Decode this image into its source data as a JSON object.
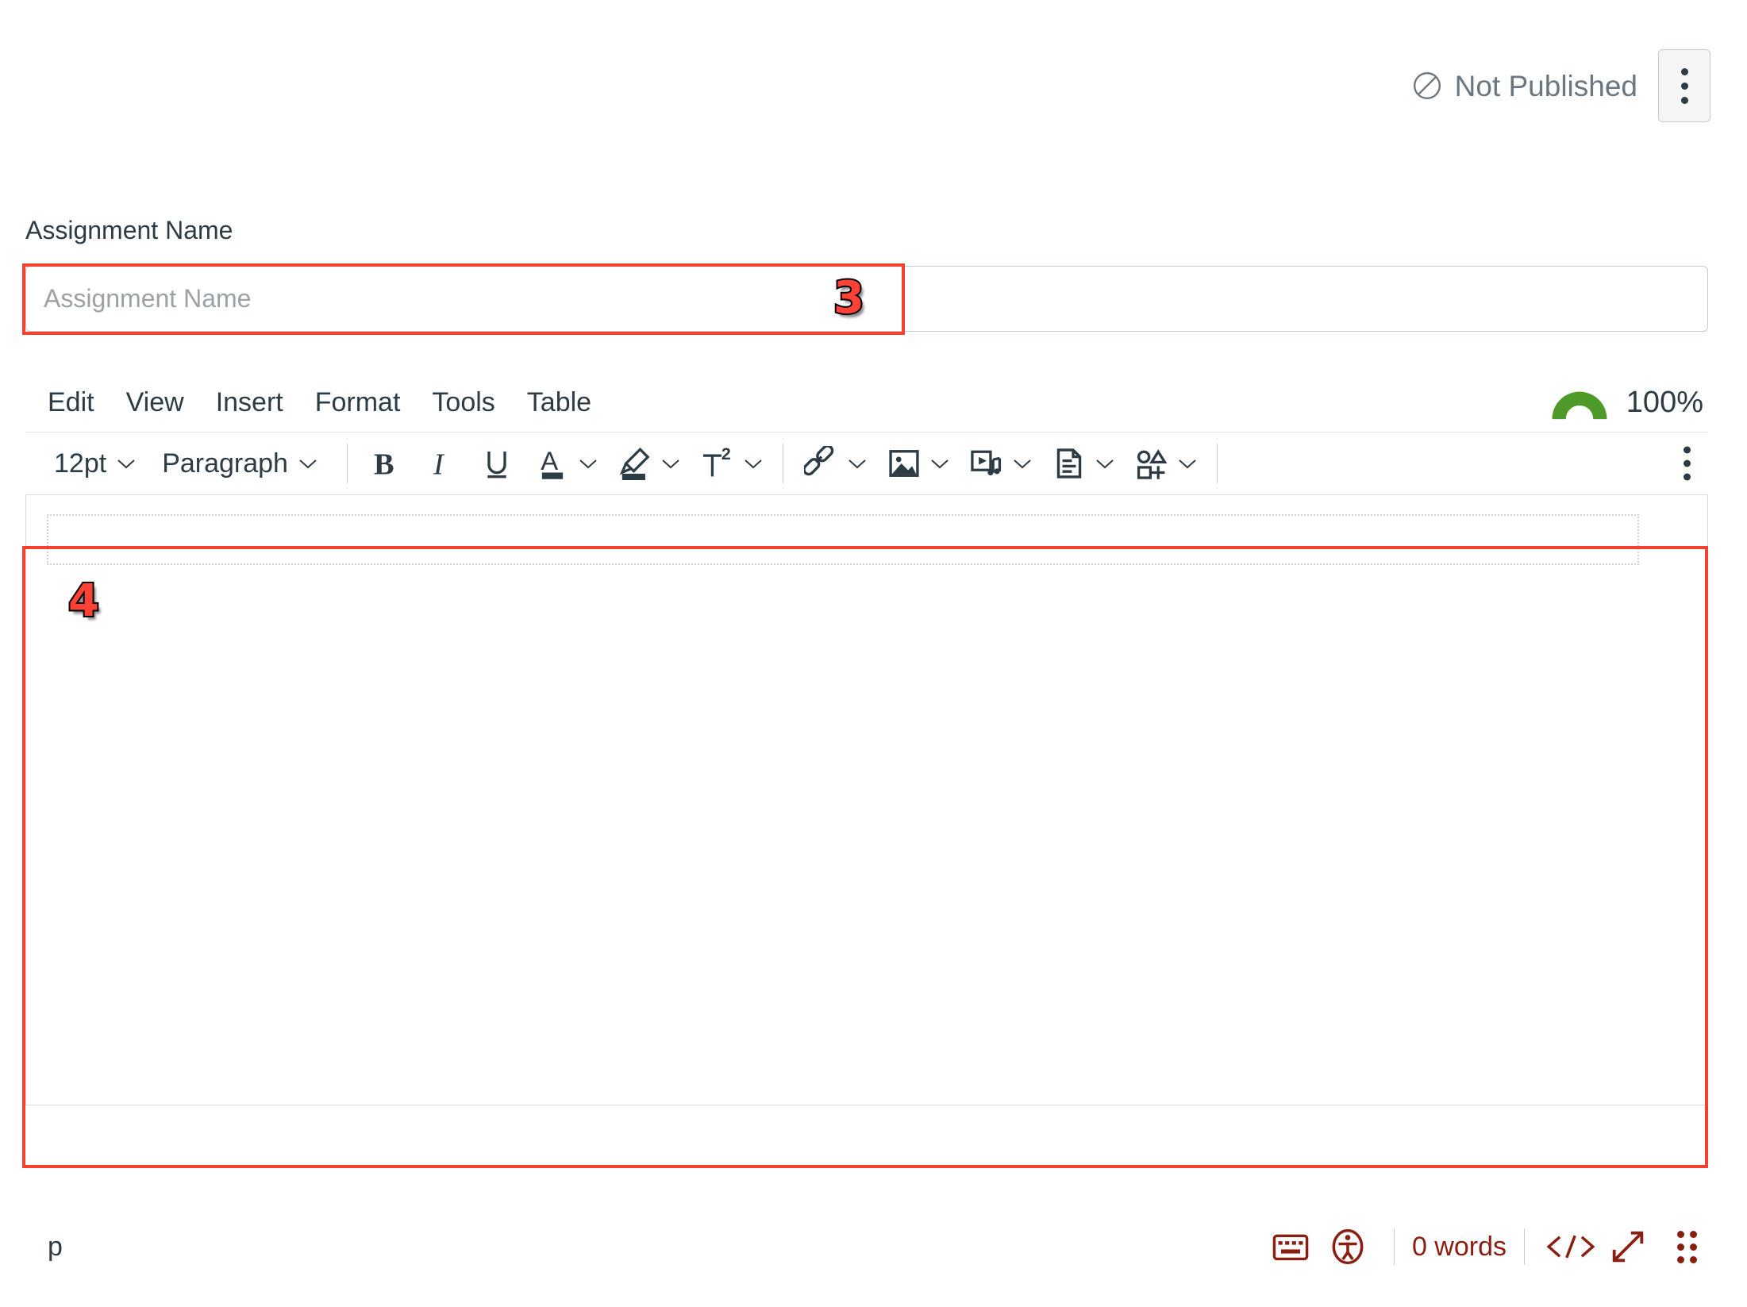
{
  "header": {
    "publish_status": "Not Published",
    "publish_icon": "circle-slash-icon",
    "kebab_icon": "kebab-menu-icon"
  },
  "assignment": {
    "label": "Assignment Name",
    "placeholder": "Assignment Name",
    "value": ""
  },
  "editor": {
    "menus": [
      {
        "label": "Edit"
      },
      {
        "label": "View"
      },
      {
        "label": "Insert"
      },
      {
        "label": "Format"
      },
      {
        "label": "Tools"
      },
      {
        "label": "Table"
      }
    ],
    "accessibility": {
      "percent": "100%",
      "gauge_color": "#4e9a29"
    },
    "toolbar": {
      "font_size": "12pt",
      "block_format": "Paragraph",
      "buttons": [
        {
          "name": "bold-icon",
          "title": "Bold"
        },
        {
          "name": "italic-icon",
          "title": "Italic"
        },
        {
          "name": "underline-icon",
          "title": "Underline"
        },
        {
          "name": "text-color-icon",
          "title": "Text Color"
        },
        {
          "name": "highlighter-icon",
          "title": "Background Color"
        },
        {
          "name": "superscript-icon",
          "title": "Superscript"
        },
        {
          "name": "link-icon",
          "title": "Link"
        },
        {
          "name": "image-icon",
          "title": "Image"
        },
        {
          "name": "media-icon",
          "title": "Media"
        },
        {
          "name": "document-icon",
          "title": "Document"
        },
        {
          "name": "apps-icon",
          "title": "Apps"
        }
      ],
      "overflow_icon": "kebab-menu-icon"
    },
    "body": {
      "content": "",
      "paragraph_placeholder": ""
    }
  },
  "statusbar": {
    "element_path": "p",
    "word_count": "0 words",
    "keyboard_icon": "keyboard-icon",
    "accessibility_icon": "accessibility-checker-icon",
    "html_editor_label": "</>",
    "fullscreen_icon": "fullscreen-icon",
    "resize_icon": "resize-handle-icon",
    "accent_color": "#8a1f11"
  },
  "annotations": [
    {
      "number": "3",
      "target": "assignment-name-input"
    },
    {
      "number": "4",
      "target": "editor-body"
    }
  ]
}
